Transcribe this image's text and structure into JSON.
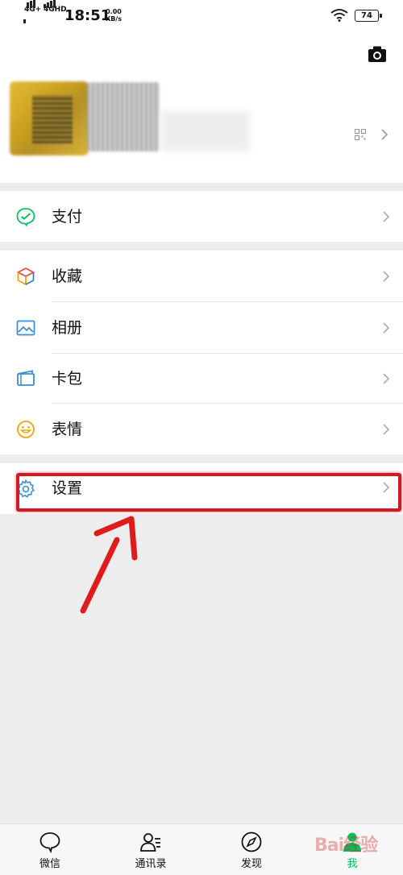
{
  "status_bar": {
    "network1": "4G+",
    "network2": "4GHD",
    "time": "18:51",
    "speed_value": "0.00",
    "speed_unit": "KB/s",
    "battery": "74"
  },
  "profile": {
    "camera_icon": "camera-icon",
    "qr_icon": "qr-code-icon"
  },
  "menu": {
    "pay": "支付",
    "favorites": "收藏",
    "album": "相册",
    "cards": "卡包",
    "stickers": "表情",
    "settings": "设置"
  },
  "tabs": [
    {
      "label": "微信",
      "icon": "chat-bubble-icon"
    },
    {
      "label": "通讯录",
      "icon": "contacts-icon"
    },
    {
      "label": "发现",
      "icon": "compass-icon"
    },
    {
      "label": "我",
      "icon": "person-icon"
    }
  ],
  "watermark": "Bai经验",
  "colors": {
    "accent": "#07c160",
    "annotation_red": "#d21a26",
    "background": "#ededed"
  }
}
